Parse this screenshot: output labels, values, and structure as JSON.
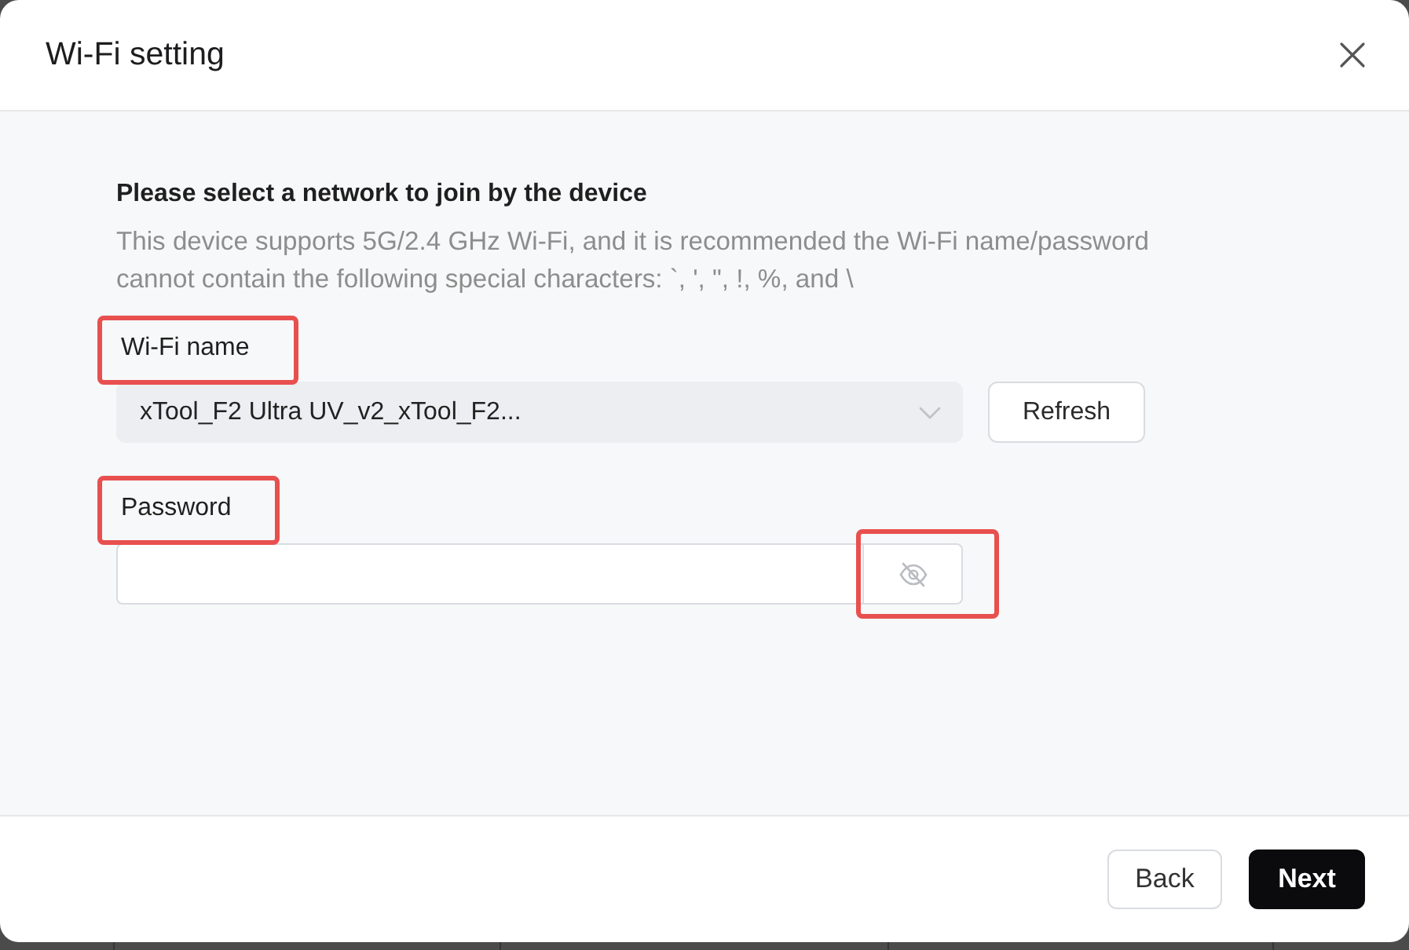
{
  "dialog": {
    "title": "Wi-Fi setting"
  },
  "intro": {
    "heading": "Please select a network to join by the device",
    "note": "This device supports 5G/2.4 GHz Wi-Fi, and it is recommended the Wi-Fi name/password cannot contain the following special characters: `, ', \", !, %, and \\"
  },
  "fields": [
    {
      "kind": "select",
      "label": "Wi-Fi name",
      "label_highlighted": true,
      "value": "xTool_F2 Ultra UV_v2_xTool_F2...",
      "button": "Refresh"
    },
    {
      "kind": "password",
      "label": "Password",
      "label_highlighted": true,
      "password_visible": false,
      "toggle_highlighted": true
    }
  ],
  "footer": {
    "buttons": [
      {
        "label": "Back",
        "kind": "secondary"
      },
      {
        "label": "Next",
        "kind": "primary"
      }
    ]
  }
}
